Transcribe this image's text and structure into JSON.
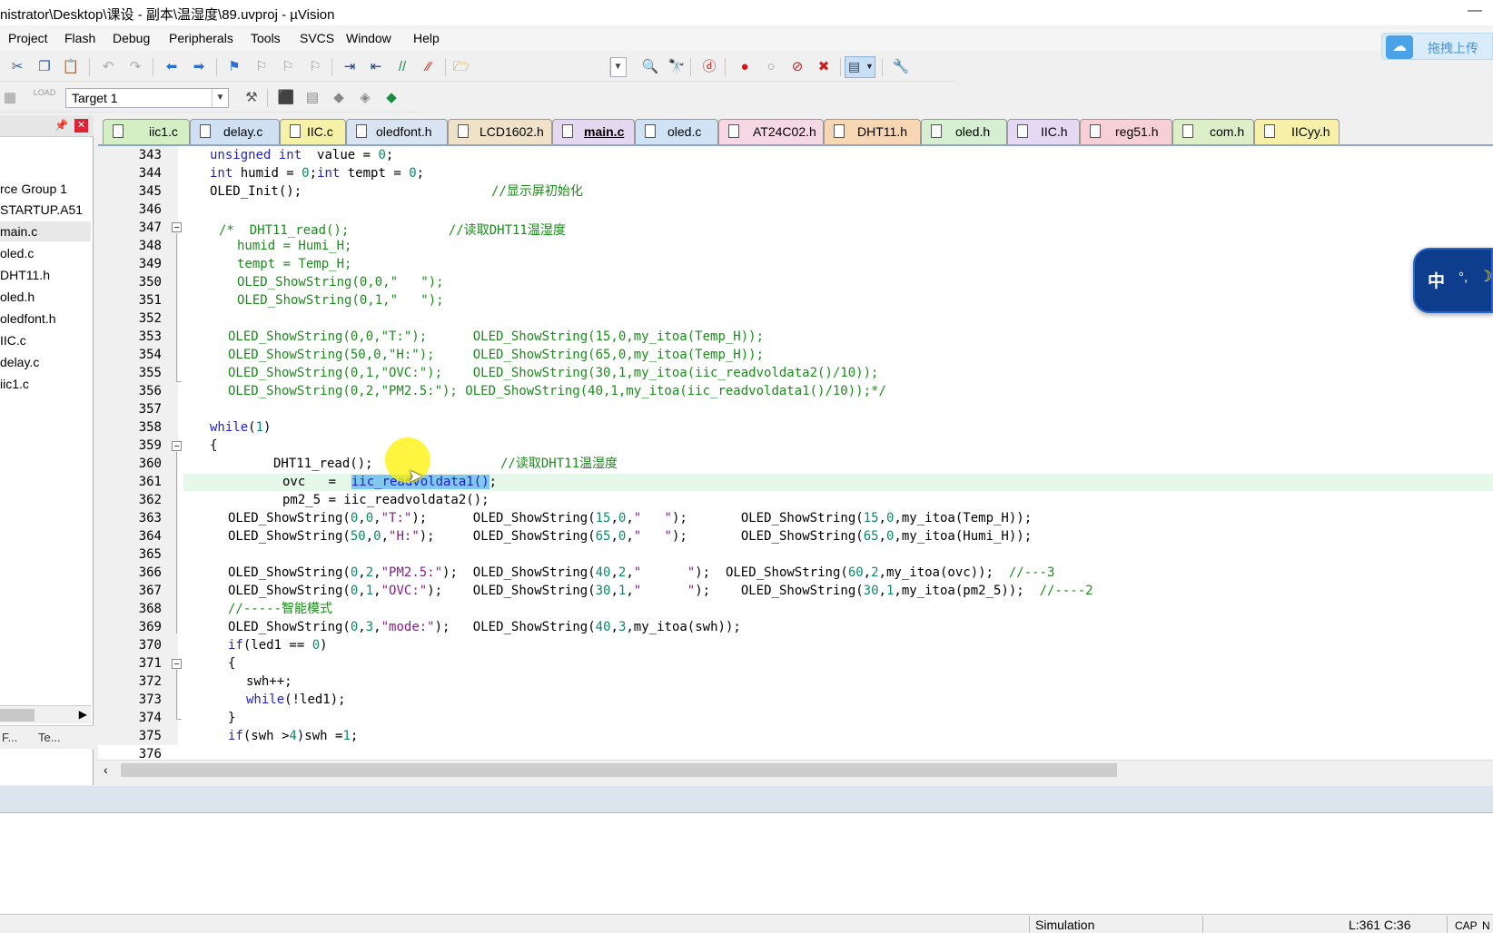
{
  "window": {
    "title": "nistrator\\Desktop\\课设 - 副本\\温湿度\\89.uvproj - µVision",
    "minimize_glyph": "—"
  },
  "menu": [
    "Project",
    "Flash",
    "Debug",
    "Peripherals",
    "Tools",
    "SVCS",
    "Window",
    "Help"
  ],
  "cloud_upload": {
    "label": "拖拽上传"
  },
  "toolbar2": {
    "load_label": "LOAD",
    "target": "Target 1"
  },
  "project_panel": {
    "items": [
      {
        "label": "rce Group 1"
      },
      {
        "label": "STARTUP.A51"
      },
      {
        "label": "main.c"
      },
      {
        "label": "oled.c"
      },
      {
        "label": "DHT11.h"
      },
      {
        "label": "oled.h"
      },
      {
        "label": "oledfont.h"
      },
      {
        "label": "IIC.c"
      },
      {
        "label": "delay.c"
      },
      {
        "label": "iic1.c"
      }
    ],
    "bottom_tabs": [
      "F...",
      "Te..."
    ]
  },
  "tabs": [
    {
      "label": "iic1.c",
      "color": "#d4efc4"
    },
    {
      "label": "delay.c",
      "color": "#cfe0f3"
    },
    {
      "label": "IIC.c",
      "color": "#f6f1a8"
    },
    {
      "label": "oledfont.h",
      "color": "#d9e4f2"
    },
    {
      "label": "LCD1602.h",
      "color": "#f0e2c8"
    },
    {
      "label": "main.c",
      "color": "#e4d8f0"
    },
    {
      "label": "oled.c",
      "color": "#cfe3f5"
    },
    {
      "label": "AT24C02.h",
      "color": "#f6d8e4"
    },
    {
      "label": "DHT11.h",
      "color": "#f7d6b4"
    },
    {
      "label": "oled.h",
      "color": "#d6efd2"
    },
    {
      "label": "IIC.h",
      "color": "#e4d8f3"
    },
    {
      "label": "reg51.h",
      "color": "#f6d0d4"
    },
    {
      "label": "com.h",
      "color": "#ddefc8"
    },
    {
      "label": "IICyy.h",
      "color": "#f7f0a8"
    }
  ],
  "active_tab": "main.c",
  "code_lines": [
    "343",
    "344",
    "345",
    "346",
    "347",
    "348",
    "349",
    "350",
    "351",
    "352",
    "353",
    "354",
    "355",
    "356",
    "357",
    "358",
    "359",
    "360",
    "361",
    "362",
    "363",
    "364",
    "365",
    "366",
    "367",
    "368",
    "369",
    "370",
    "371",
    "372",
    "373",
    "374",
    "375",
    "376"
  ],
  "code": {
    "l343": [
      "unsigned",
      "int",
      "  value = ",
      "0",
      ";"
    ],
    "l344": [
      "int",
      " humid = ",
      "0",
      ";",
      "int",
      " tempt = ",
      "0",
      ";"
    ],
    "l345": [
      "OLED_Init();",
      "//显示屏初始化"
    ],
    "l347": [
      "/*  DHT11_read();             //读取DHT11温湿度"
    ],
    "l348": [
      "humid = Humi_H;"
    ],
    "l349": [
      "tempt = Temp_H;"
    ],
    "l350": [
      "OLED_ShowString(0,0,\"   \");"
    ],
    "l351": [
      "OLED_ShowString(0,1,\"   \");"
    ],
    "l353": [
      "OLED_ShowString(0,0,\"T:\");      OLED_ShowString(15,0,my_itoa(Temp_H));"
    ],
    "l354": [
      "OLED_ShowString(50,0,\"H:\");     OLED_ShowString(65,0,my_itoa(Temp_H));"
    ],
    "l355": [
      "OLED_ShowString(0,1,\"OVC:\");    OLED_ShowString(30,1,my_itoa(iic_readvoldata2()/10));"
    ],
    "l356": [
      "OLED_ShowString(0,2,\"PM2.5:\"); OLED_ShowString(40,1,my_itoa(iic_readvoldata1()/10));*/"
    ],
    "l358": [
      "while",
      "(",
      "1",
      ")"
    ],
    "l359": [
      "{"
    ],
    "l360": [
      "DHT11_read();",
      "//读取DHT11温湿度"
    ],
    "l361": [
      "ovc   =  ",
      "iic_readvoldata1()",
      ";"
    ],
    "l362": [
      "pm2_5 = iic_readvoldata2();"
    ],
    "l363": [
      "OLED_ShowString(",
      "0",
      ",",
      "0",
      ",",
      "\"T:\"",
      ");",
      "OLED_ShowString(",
      "15",
      ",",
      "0",
      ",",
      "\"   \"",
      ");",
      "OLED_ShowString(",
      "15",
      ",",
      "0",
      ",my_itoa(Temp_H));"
    ],
    "l364": [
      "OLED_ShowString(",
      "50",
      ",",
      "0",
      ",",
      "\"H:\"",
      ");",
      "OLED_ShowString(",
      "65",
      ",",
      "0",
      ",",
      "\"   \"",
      ");",
      "OLED_ShowString(",
      "65",
      ",",
      "0",
      ",my_itoa(Humi_H));"
    ],
    "l366": [
      "OLED_ShowString(",
      "0",
      ",",
      "2",
      ",",
      "\"PM2.5:\"",
      ");",
      "OLED_ShowString(",
      "40",
      ",",
      "2",
      ",",
      "\"      \"",
      ");",
      "OLED_ShowString(",
      "60",
      ",",
      "2",
      ",my_itoa(ovc));",
      "//---3"
    ],
    "l367": [
      "OLED_ShowString(",
      "0",
      ",",
      "1",
      ",",
      "\"OVC:\"",
      ");",
      "OLED_ShowString(",
      "30",
      ",",
      "1",
      ",",
      "\"      \"",
      ");",
      "OLED_ShowString(",
      "30",
      ",",
      "1",
      ",my_itoa(pm2_5));",
      "//----2"
    ],
    "l368": [
      "//-----智能模式"
    ],
    "l369": [
      "OLED_ShowString(",
      "0",
      ",",
      "3",
      ",",
      "\"mode:\"",
      ");",
      "OLED_ShowString(",
      "40",
      ",",
      "3",
      ",my_itoa(swh));"
    ],
    "l370": [
      "if",
      "(led1 == ",
      "0",
      ")"
    ],
    "l371": [
      "{"
    ],
    "l372": [
      "swh++;"
    ],
    "l373": [
      "while",
      "(!led1);"
    ],
    "l374": [
      "}"
    ],
    "l375": [
      "if",
      "(swh >",
      "4",
      ")swh =",
      "1",
      ";"
    ]
  },
  "status": {
    "mode": "Simulation",
    "position": "L:361 C:36",
    "cap": "CAP",
    "num": "N"
  },
  "ime": {
    "lang": "中",
    "punct": "°,",
    "moon": "☽"
  }
}
